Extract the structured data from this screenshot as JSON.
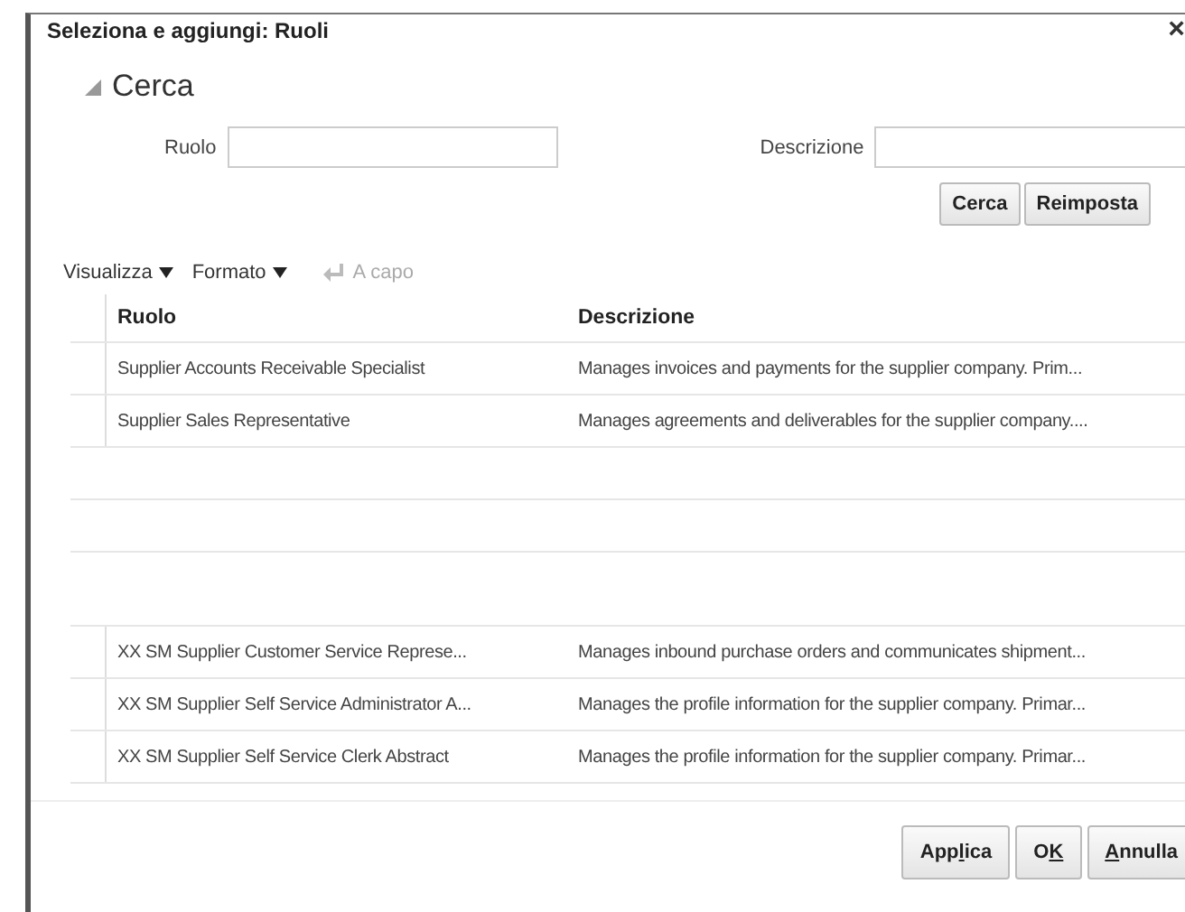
{
  "dialog": {
    "title": "Seleziona e aggiungi: Ruoli",
    "close": "×"
  },
  "search": {
    "heading": "Cerca",
    "expanded": true,
    "fields": [
      {
        "label": "Ruolo"
      },
      {
        "label": "Descrizione"
      }
    ],
    "buttons": [
      "Cerca",
      "Reimposta"
    ]
  },
  "toolbar": [
    {
      "label": "Visualizza",
      "kind": "menu",
      "disabled": false
    },
    {
      "label": "Formato",
      "kind": "menu",
      "disabled": false
    },
    {
      "label": "A capo",
      "kind": "toggle",
      "disabled": true
    }
  ],
  "table": {
    "columns": [
      "Ruolo",
      "Descrizione"
    ],
    "rows": [
      {
        "cells": [
          "Supplier Accounts Receivable Specialist",
          "Manages invoices and payments for the supplier company. Prim..."
        ]
      },
      {
        "cells": [
          "Supplier Sales Representative",
          "Manages agreements and deliverables for the supplier company...."
        ]
      },
      {
        "cells": [
          "XX SM Supplier Customer Service Represe...",
          "Manages inbound purchase orders and communicates shipment..."
        ]
      },
      {
        "cells": [
          "XX SM Supplier Self Service Administrator A...",
          "Manages the profile information for the supplier company. Primar..."
        ]
      },
      {
        "cells": [
          "XX SM Supplier Self Service Clerk Abstract",
          "Manages the profile information for the supplier company. Primar..."
        ]
      }
    ]
  },
  "footer_buttons": [
    {
      "before": "App",
      "access_key": "l",
      "after": "ica"
    },
    {
      "before": "O",
      "access_key": "K"
    },
    {
      "access_key": "A",
      "after": "nnulla"
    }
  ]
}
